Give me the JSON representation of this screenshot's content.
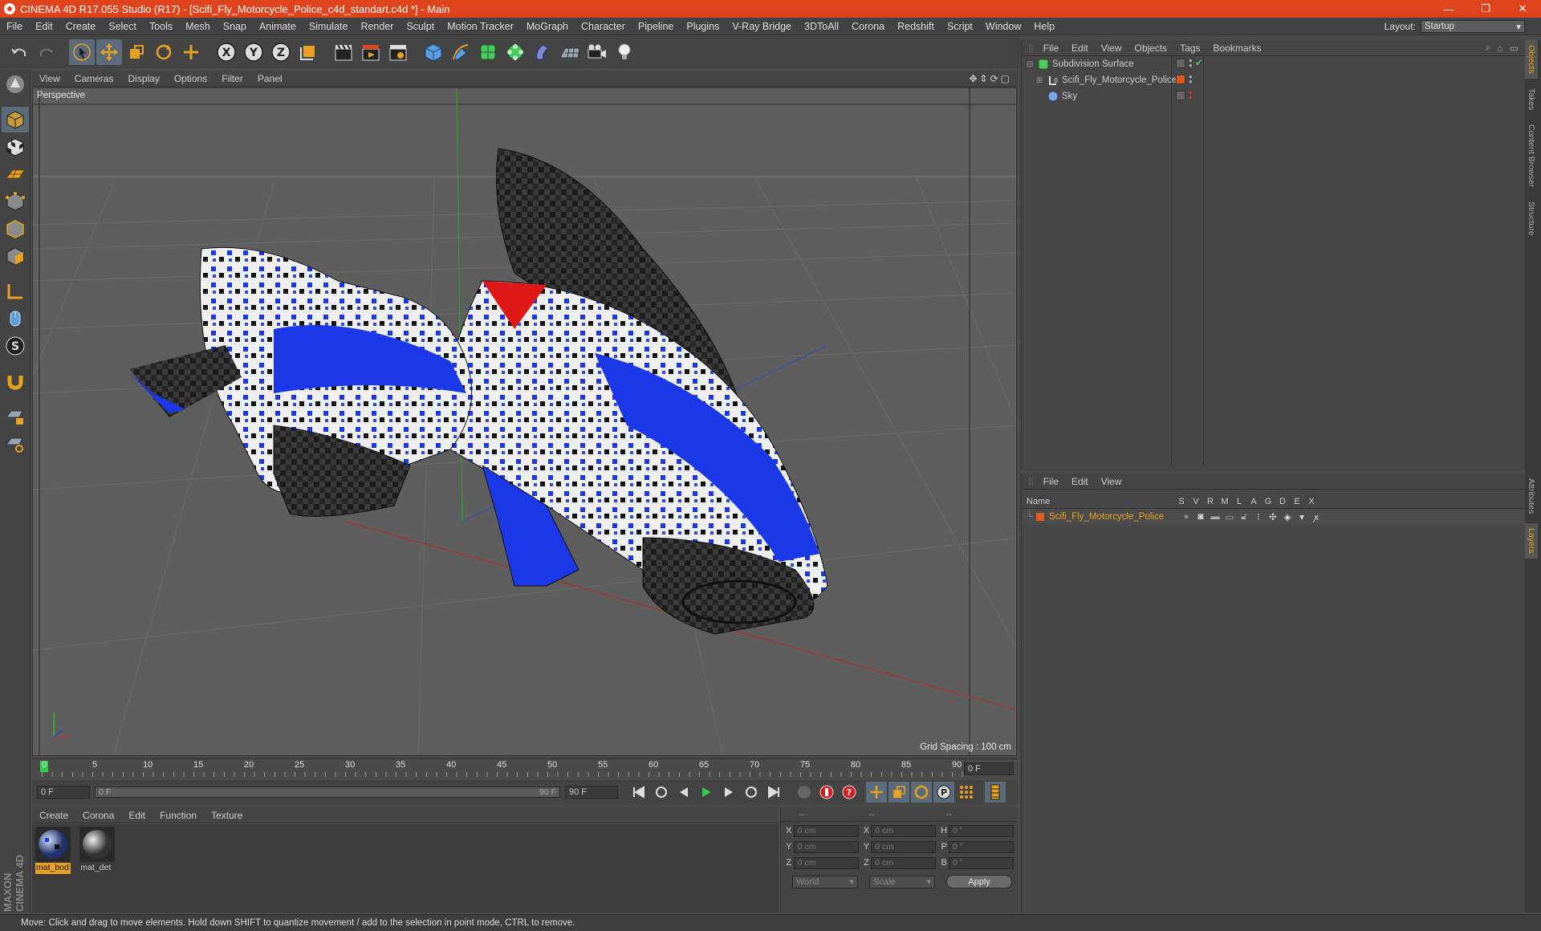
{
  "window": {
    "title": "CINEMA 4D R17.055 Studio (R17) - [Scifi_Fly_Motorcycle_Police_c4d_standart.c4d *] - Main",
    "controls": {
      "minimize": "—",
      "restore": "❐",
      "close": "✕"
    }
  },
  "menubar": {
    "items": [
      "File",
      "Edit",
      "Create",
      "Select",
      "Tools",
      "Mesh",
      "Snap",
      "Animate",
      "Simulate",
      "Render",
      "Sculpt",
      "Motion Tracker",
      "MoGraph",
      "Character",
      "Pipeline",
      "Plugins",
      "V-Ray Bridge",
      "3DToAll",
      "Corona",
      "Redshift",
      "Script",
      "Window",
      "Help"
    ],
    "layout_label": "Layout:",
    "layout_value": "Startup"
  },
  "viewport": {
    "menu": [
      "View",
      "Cameras",
      "Display",
      "Options",
      "Filter",
      "Panel"
    ],
    "label": "Perspective",
    "grid_spacing": "Grid Spacing : 100 cm"
  },
  "timeline": {
    "ticks": [
      "0",
      "5",
      "10",
      "15",
      "20",
      "25",
      "30",
      "35",
      "40",
      "45",
      "50",
      "55",
      "60",
      "65",
      "70",
      "75",
      "80",
      "85",
      "90"
    ],
    "current_frame": "0 F",
    "start_field": "0 F",
    "range_start": "0 F",
    "range_end": "90 F",
    "end_field": "90 F"
  },
  "materials": {
    "menu": [
      "Create",
      "Corona",
      "Edit",
      "Function",
      "Texture"
    ],
    "items": [
      {
        "name": "mat_bod",
        "selected": true
      },
      {
        "name": "mat_det",
        "selected": false
      }
    ]
  },
  "coordinates": {
    "headers": [
      "--",
      "--",
      "--"
    ],
    "rows": [
      {
        "a": "X",
        "av": "0 cm",
        "b": "X",
        "bv": "0 cm",
        "c": "H",
        "cv": "0 °"
      },
      {
        "a": "Y",
        "av": "0 cm",
        "b": "Y",
        "bv": "0 cm",
        "c": "P",
        "cv": "0 °"
      },
      {
        "a": "Z",
        "av": "0 cm",
        "b": "Z",
        "bv": "0 cm",
        "c": "B",
        "cv": "0 °"
      }
    ],
    "mode": "World",
    "scale": "Scale",
    "apply": "Apply"
  },
  "objects_panel": {
    "menu": [
      "File",
      "Edit",
      "View",
      "Objects",
      "Tags",
      "Bookmarks"
    ],
    "items": [
      {
        "name": "Subdivision Surface",
        "icon": "subdivision-icon"
      },
      {
        "name": "Scifi_Fly_Motorcycle_Police",
        "icon": "null-object-icon"
      },
      {
        "name": "Sky",
        "icon": "sky-icon"
      }
    ]
  },
  "layers_panel": {
    "menu": [
      "File",
      "Edit",
      "View"
    ],
    "columns": [
      "Name",
      "S",
      "V",
      "R",
      "M",
      "L",
      "A",
      "G",
      "D",
      "E",
      "X"
    ],
    "layer": "Scifi_Fly_Motorcycle_Police"
  },
  "right_tabs": [
    "Objects",
    "Takes",
    "Content Browser",
    "Structure",
    "Attributes",
    "Layers"
  ],
  "brand": "MAXON CINEMA 4D",
  "status": "Move: Click and drag to move elements. Hold down SHIFT to quantize movement / add to the selection in point mode, CTRL to remove.",
  "colors": {
    "titlebar": "#e0441c",
    "accent_orange": "#e8a020",
    "selection_blue": "#5b6b7c",
    "viewport_bg": "#5e5e5e"
  }
}
